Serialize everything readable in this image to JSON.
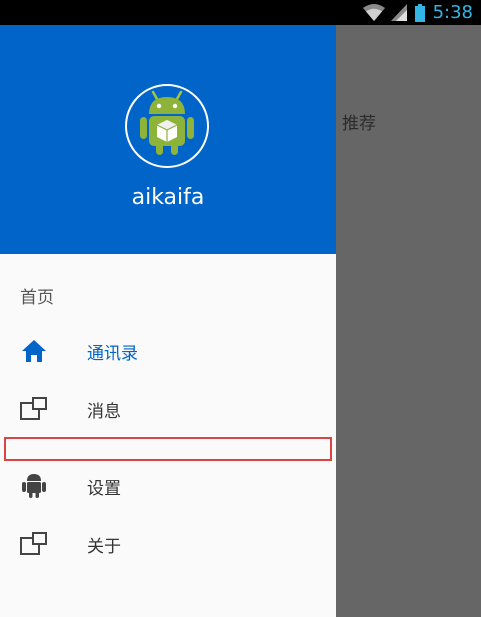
{
  "status_bar": {
    "time": "5:38",
    "icons": [
      "wifi-icon",
      "signal-icon",
      "battery-icon"
    ],
    "accent_color": "#33b5e5"
  },
  "background": {
    "text": "推荐"
  },
  "drawer": {
    "header": {
      "username": "aikaifa",
      "background_color": "#0064c8",
      "avatar_icon": "android-robot-icon"
    },
    "section_header": "首页",
    "items": [
      {
        "label": "通讯录",
        "icon": "home-icon",
        "active": true
      },
      {
        "label": "消息",
        "icon": "window-icon",
        "active": false
      },
      {
        "label": "设置",
        "icon": "android-icon",
        "active": false
      },
      {
        "label": "关于",
        "icon": "window-icon",
        "active": false
      }
    ],
    "active_color": "#0064c8"
  },
  "overlay": {
    "highlight_color": "#d94444"
  }
}
